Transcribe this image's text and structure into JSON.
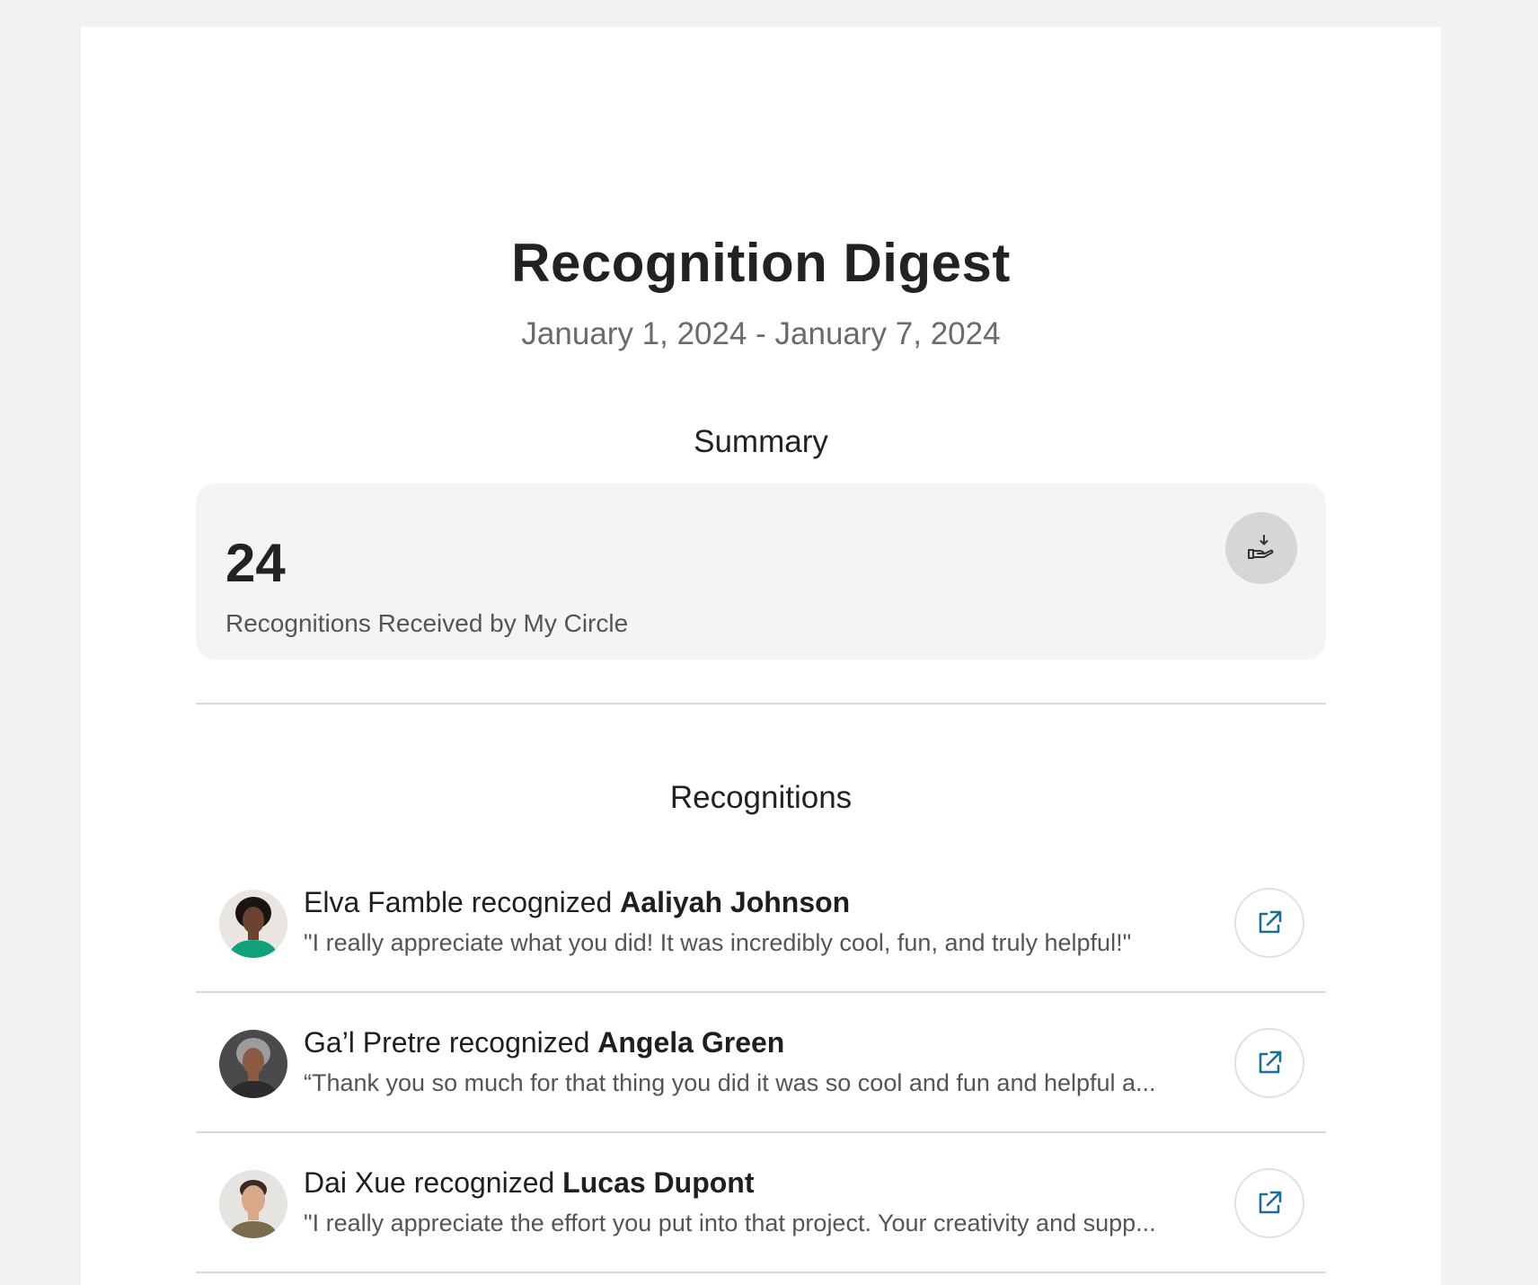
{
  "header": {
    "title": "Recognition Digest",
    "date_range": "January 1, 2024 - January 7, 2024"
  },
  "summary": {
    "heading": "Summary",
    "count": "24",
    "label": "Recognitions Received by My Circle",
    "icon": "hand-receive-icon"
  },
  "recognitions": {
    "heading": "Recognitions",
    "items": [
      {
        "giver": "Elva Famble",
        "verb": "recognized",
        "recipient": "Aaliyah Johnson",
        "quote": "\"I really appreciate what you did! It was incredibly cool, fun, and truly helpful!\"",
        "icon": "external-link-icon"
      },
      {
        "giver": "Ga’l Pretre",
        "verb": "recognized",
        "recipient": "Angela Green",
        "quote": "“Thank you so much for that thing you did it was so cool and fun and helpful a...",
        "icon": "external-link-icon"
      },
      {
        "giver": "Dai Xue",
        "verb": "recognized",
        "recipient": "Lucas Dupont",
        "quote": "\"I really appreciate the effort you put into that project. Your creativity and supp...",
        "icon": "external-link-icon"
      }
    ]
  },
  "colors": {
    "page_bg": "#f2f2f2",
    "card_bg": "#ffffff",
    "summary_bg": "#f4f4f4",
    "link_icon": "#1a6f96",
    "muted_text": "#6b6b6b"
  }
}
